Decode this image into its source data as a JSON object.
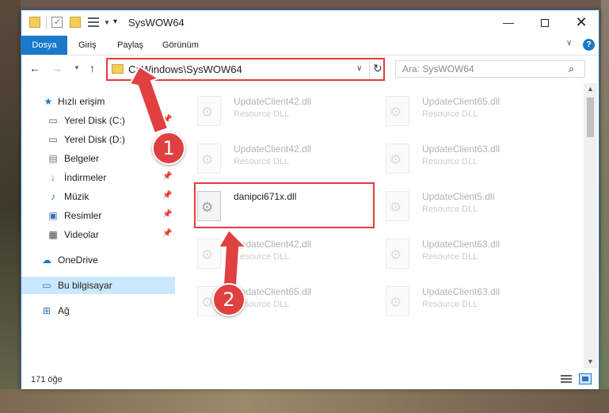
{
  "window": {
    "title": "SysWOW64",
    "buttons": {
      "minimize": "—",
      "close": "✕"
    }
  },
  "ribbon": {
    "tabs": [
      "Dosya",
      "Giriş",
      "Paylaş",
      "Görünüm"
    ],
    "collapse": "∨",
    "help": "?"
  },
  "address": {
    "path": "C:\\Windows\\SysWOW64",
    "search_placeholder": "Ara: SysWOW64"
  },
  "nav": {
    "items": [
      {
        "label": "Hızlı erişim",
        "icon": "star-icon",
        "pinned": false
      },
      {
        "label": "Yerel Disk (C:)",
        "icon": "drive-icon",
        "pinned": true
      },
      {
        "label": "Yerel Disk (D:)",
        "icon": "drive-icon",
        "pinned": false
      },
      {
        "label": "Belgeler",
        "icon": "document-icon",
        "pinned": true
      },
      {
        "label": "İndirmeler",
        "icon": "download-icon",
        "pinned": true
      },
      {
        "label": "Müzik",
        "icon": "music-icon",
        "pinned": true
      },
      {
        "label": "Resimler",
        "icon": "picture-icon",
        "pinned": true
      },
      {
        "label": "Videolar",
        "icon": "video-icon",
        "pinned": true
      },
      {
        "label": "OneDrive",
        "icon": "cloud-icon",
        "pinned": false
      },
      {
        "label": "Bu bilgisayar",
        "icon": "computer-icon",
        "pinned": false,
        "selected": true
      },
      {
        "label": "Ağ",
        "icon": "network-icon",
        "pinned": false
      }
    ]
  },
  "files": [
    {
      "name": "UpdateClient42.dll",
      "type": "Resource DLL",
      "highlighted": false
    },
    {
      "name": "UpdateClient65.dll",
      "type": "Resource DLL",
      "highlighted": false
    },
    {
      "name": "UpdateClient42.dll",
      "type": "Resource DLL",
      "highlighted": false
    },
    {
      "name": "UpdateClient63.dll",
      "type": "Resource DLL",
      "highlighted": false
    },
    {
      "name": "danipci671x.dll",
      "type": "",
      "highlighted": true
    },
    {
      "name": "UpdateClient5.dll",
      "type": "Resource DLL",
      "highlighted": false
    },
    {
      "name": "UpdateClient42.dll",
      "type": "Resource DLL",
      "highlighted": false
    },
    {
      "name": "UpdateClient63.dll",
      "type": "Resource DLL",
      "highlighted": false
    },
    {
      "name": "UpdateClient65.dll",
      "type": "Resource DLL",
      "highlighted": false
    },
    {
      "name": "UpdateClient63.dll",
      "type": "Resource DLL",
      "highlighted": false
    }
  ],
  "status": {
    "count": "171 öğe"
  },
  "callouts": [
    "1",
    "2"
  ],
  "colors": {
    "accent": "#1979ca",
    "highlight": "#e53b3b",
    "badge": "#e04040"
  }
}
